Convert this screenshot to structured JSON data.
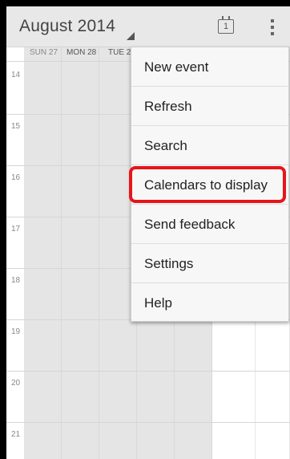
{
  "header": {
    "month_title": "August 2014",
    "today_icon_label": "1"
  },
  "week": {
    "days": [
      "SUN 27",
      "MON 28",
      "TUE 2"
    ]
  },
  "hours": [
    "14",
    "15",
    "16",
    "17",
    "18",
    "19",
    "20",
    "21"
  ],
  "menu": {
    "items": [
      {
        "label": "New event"
      },
      {
        "label": "Refresh"
      },
      {
        "label": "Search"
      },
      {
        "label": "Calendars to display"
      },
      {
        "label": "Send feedback"
      },
      {
        "label": "Settings"
      },
      {
        "label": "Help"
      }
    ]
  },
  "colors": {
    "highlight": "#e8141b",
    "past_day_bg": "#e5e5e5"
  }
}
